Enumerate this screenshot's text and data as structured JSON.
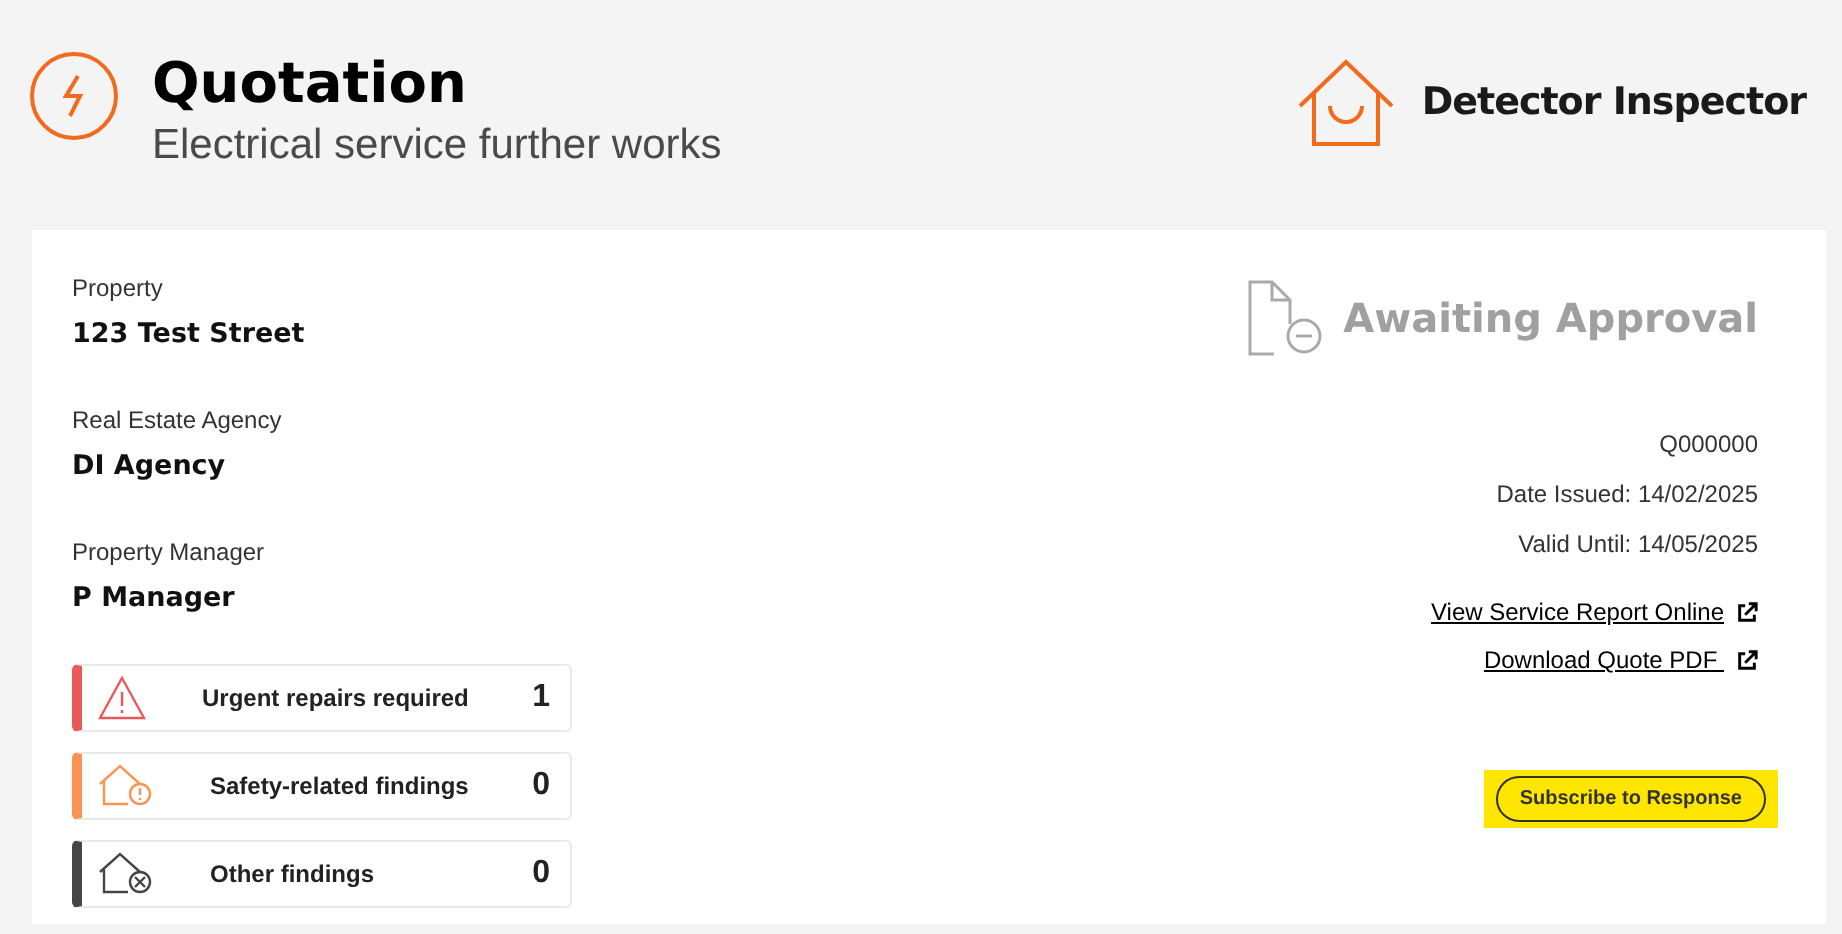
{
  "header": {
    "title": "Quotation",
    "subtitle": "Electrical service further works",
    "brand": "Detector Inspector"
  },
  "details": [
    {
      "label": "Property",
      "value": "123 Test Street"
    },
    {
      "label": "Real Estate Agency",
      "value": "DI Agency"
    },
    {
      "label": "Property Manager",
      "value": "P Manager"
    }
  ],
  "findings": [
    {
      "kind": "urgent",
      "label": "Urgent repairs required",
      "count": "1",
      "color": "#e85a5a"
    },
    {
      "kind": "safety",
      "label": "Safety-related findings",
      "count": "0",
      "color": "#fb9450"
    },
    {
      "kind": "other",
      "label": "Other findings",
      "count": "0",
      "color": "#454545"
    }
  ],
  "status": "Awaiting Approval",
  "meta": [
    "Q000000",
    "Date Issued: 14/02/2025",
    "Valid Until: 14/05/2025"
  ],
  "links": [
    "View Service Report Online",
    "Download Quote PDF "
  ],
  "subscribe_button": "Subscribe to Response"
}
